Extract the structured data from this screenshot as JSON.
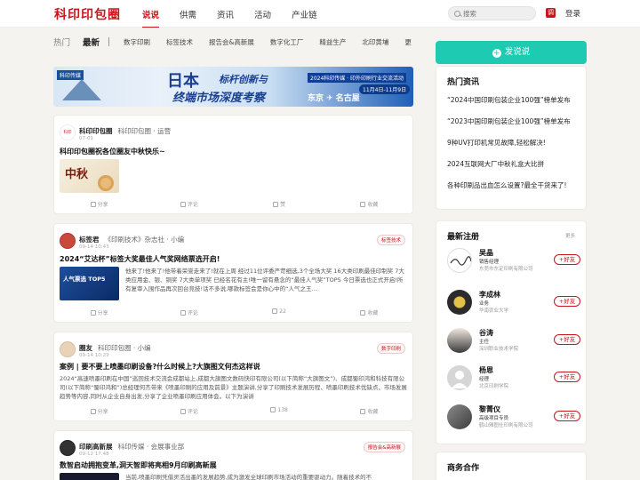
{
  "header": {
    "logo": "科印印包圈",
    "nav": [
      "说说",
      "供需",
      "资讯",
      "活动",
      "产业链"
    ],
    "search_placeholder": "搜索",
    "app_icon": "调",
    "login": "登录"
  },
  "subnav": {
    "hot": "热门",
    "latest": "最新",
    "items": [
      "数字印刷",
      "标签技术",
      "报告会&高新展",
      "数字化工厂",
      "精益生产",
      "北印黄埔",
      "更"
    ]
  },
  "banner": {
    "logo": "科印传媒",
    "t1": "日本",
    "t2": "标杆创新与",
    "t3": "终端市场深度考察",
    "t4": "2024科印传媒 · 印外印刷行业交流活动",
    "date": "11月4日-11月9日",
    "cities": "东京 ✈ 名古屋"
  },
  "posts": [
    {
      "author": "科印印包圈",
      "source": "科印印包圈 · 运营",
      "time": "07-01",
      "tag": "",
      "title": "科印印包圈祝各位圈友中秋快乐~",
      "body": "",
      "thumb_text": "中秋",
      "actions": [
        "分享",
        "评论",
        "赞",
        "收藏"
      ]
    },
    {
      "author": "标签君",
      "source": "《印刷技术》杂志社 · 小编",
      "time": "09-14 10:43",
      "tag": "标签技术",
      "title": "2024“艾达杯”标签大奖最佳人气奖网络票选开启!",
      "body": "他来了!他来了!他带着荣誉走来了!就在上周 经过11位评委严苛细选,3个全场大奖 16大类印刷最佳印制奖 7大类应用金、银、铜奖 7大类单项奖 已经名花有主!唯一留有悬念的“最佳人气奖”TOP5 今日票选也正式开启!所有复审入围作品再次回台竞技!话不多说,哪款标签会是你心中的“人气之王…",
      "thumb_text": "人气票选 TOP5",
      "actions": [
        "分享",
        "评论",
        "22",
        "收藏"
      ]
    },
    {
      "author": "圈友",
      "source": "科印印包圈 · 小编",
      "time": "09-14 10:29",
      "tag": "数字印刷",
      "title": "案例 | 要不要上喷墨印刷设备?什么时候上?大旗图文何杰这样说",
      "body": "2024“高速喷墨印刷在中国”巡回技术交流会成都站上,成都大旗图文数码快印有限公司(以下简称“大旗图文”)、成都蜀印鸿和科技有限公司(以下简称“蜀印鸿和”)总经理何杰带来《喷墨印刷的应用及前景》主题演讲,分享了印刷技术发展历程、喷墨印刷技术优缺点、市场发展趋势等内容,同时从企业自身出发,分享了企业喷墨印刷应用体会。以下为演讲",
      "thumb_text": "",
      "actions": [
        "分享",
        "评论",
        "138",
        "收藏"
      ]
    },
    {
      "author": "印刷高新展",
      "source": "科印传媒 · 会展事业部",
      "time": "09-12 17:48",
      "tag": "报告会&高新展",
      "title": "数智启动拥抱变革,洞天智即将亮相9月印刷高新展",
      "body": "当前,喷墨印刷凭借灵活出墨的发展趋势,成为激发全球印刷市场活动的重要驱动力。随着技术的不",
      "thumb_text": "",
      "actions": []
    }
  ],
  "sidebar": {
    "post_button": "发说说",
    "hot_title": "热门资讯",
    "hot_items": [
      "“2024中国印刷包装企业100强”榜单发布",
      "“2023中国印刷包装企业100强”榜单发布",
      "9种UV打印机常见故障,轻松解决!",
      "2024互联网大厂中秋礼盒大比拼",
      "各种印刷品出血怎么设置?最全干货来了!"
    ],
    "reg_title": "最新注册",
    "reg_more": "更多",
    "follow_label": "+好友",
    "users": [
      {
        "name": "吴晶",
        "role": "销售经理",
        "org": "东莞市东定印刷有限公司"
      },
      {
        "name": "李成林",
        "role": "业务",
        "org": "华南农业大学"
      },
      {
        "name": "谷涛",
        "role": "主任",
        "org": "深圳职业技术学院"
      },
      {
        "name": "杨恩",
        "role": "经理",
        "org": "北京印刷学院"
      },
      {
        "name": "黎菁仪",
        "role": "高级项目专员",
        "org": "鹤山雅图仕印刷有限公司"
      }
    ],
    "biz_title": "商务合作"
  }
}
